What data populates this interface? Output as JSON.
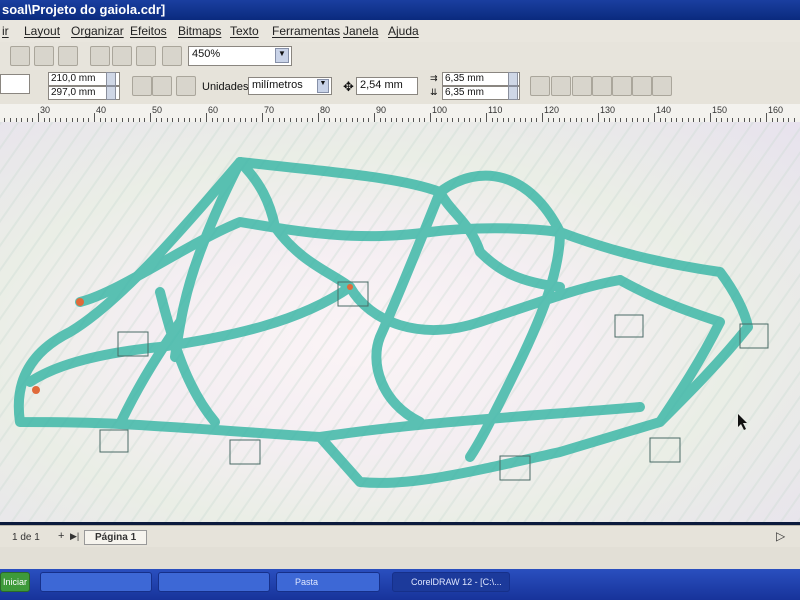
{
  "window": {
    "title": "soal\\Projeto do gaiola.cdr]"
  },
  "menu": [
    "ir",
    "Layout",
    "Organizar",
    "Efeitos",
    "Bitmaps",
    "Texto",
    "Ferramentas",
    "Janela",
    "Ajuda"
  ],
  "toolbar": {
    "zoom": "450%",
    "page_width": "210,0 mm",
    "page_height": "297,0 mm",
    "units_label": "Unidades:",
    "units_value": "milímetros",
    "nudge": "2,54 mm",
    "dup_x": "6,35 mm",
    "dup_y": "6,35 mm"
  },
  "ruler": {
    "labels": [
      "30",
      "40",
      "50",
      "60",
      "70",
      "80",
      "90",
      "100",
      "110",
      "120",
      "130",
      "140",
      "150",
      "160"
    ]
  },
  "pages": {
    "counter": "1 de 1",
    "tab": "Página 1"
  },
  "taskbar": {
    "start": "Iniciar",
    "tasks": [
      "",
      "",
      "",
      "Pasta",
      "CorelDRAW 12 - [C:\\..."
    ]
  }
}
